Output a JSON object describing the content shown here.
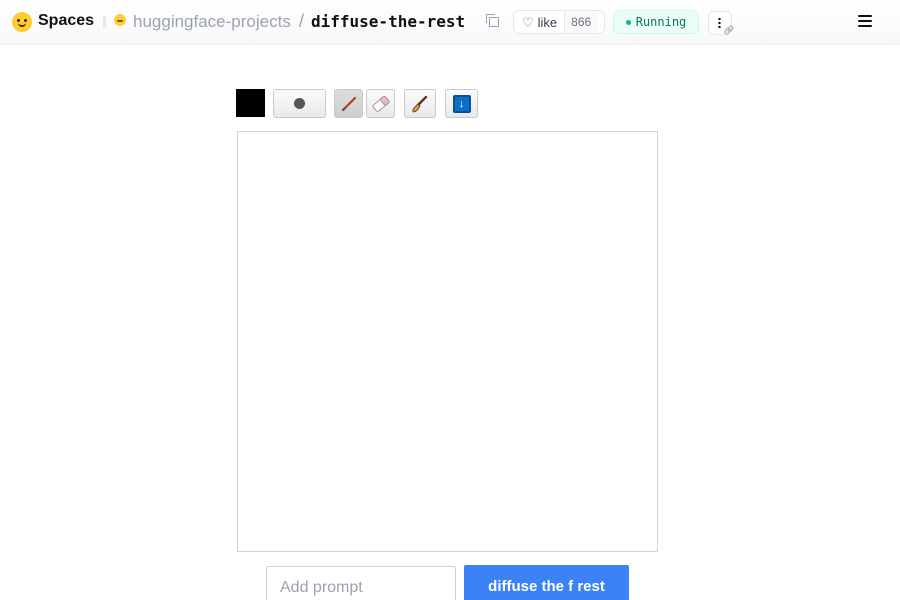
{
  "header": {
    "section_label": "Spaces",
    "org_name": "huggingface-projects",
    "separator": "/",
    "repo_name": "diffuse-the-rest",
    "like_label": "like",
    "like_count": "866",
    "status_text": "Running",
    "status_color": "#10b981"
  },
  "toolbar": {
    "selected_color": "#000000",
    "tools": [
      "color-picker",
      "brush-size",
      "pencil",
      "eraser",
      "paintbrush",
      "save"
    ],
    "active_tool": "pencil"
  },
  "prompt": {
    "placeholder": "Add prompt",
    "value": ""
  },
  "submit": {
    "label": "diffuse the f rest",
    "color": "#3b82f6"
  }
}
